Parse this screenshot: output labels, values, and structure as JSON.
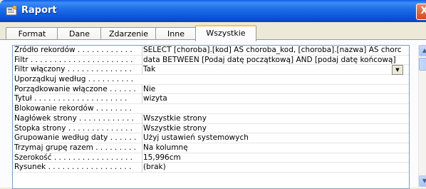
{
  "window": {
    "title": "Raport",
    "close_label": "X"
  },
  "tabs": [
    {
      "label": "Format"
    },
    {
      "label": "Dane"
    },
    {
      "label": "Zdarzenie"
    },
    {
      "label": "Inne"
    },
    {
      "label": "Wszystkie",
      "active": true
    }
  ],
  "properties": [
    {
      "label": "Źródło rekordów . . . . . . . . . . . .",
      "value": "SELECT [choroba].[kod] AS choroba_kod, [choroba].[nazwa] AS chorc"
    },
    {
      "label": "Filtr . . . . . . . . . . . . . . . . . . . . . .",
      "value": "data BETWEEN [Podaj datę początkową] AND [podaj datę końcową]"
    },
    {
      "label": "Filtr włączony . . . . . . . . . . . . . .",
      "value": "Tak"
    },
    {
      "label": "Uporządkuj według . . . . . . . . . .",
      "value": ""
    },
    {
      "label": "Porządkowanie włączone . . . . . .",
      "value": "Nie"
    },
    {
      "label": "Tytuł . . . . . . . . . . . . . . . . . . . .",
      "value": "wizyta"
    },
    {
      "label": "Blokowanie rekordów . . . . . . . .",
      "value": ""
    },
    {
      "label": "Nagłówek strony . . . . . . . . . . . .",
      "value": "Wszystkie strony"
    },
    {
      "label": "Stopka strony . . . . . . . . . . . . . .",
      "value": "Wszystkie strony"
    },
    {
      "label": "Grupowanie według daty . . . . . .",
      "value": "Użyj ustawień systemowych"
    },
    {
      "label": "Trzymaj grupę razem . . . . . . . . .",
      "value": "Na kolumnę"
    },
    {
      "label": "Szerokość . . . . . . . . . . . . . . . . .",
      "value": "15,996cm"
    },
    {
      "label": "Rysunek . . . . . . . . . . . . . . . . . .",
      "value": "(brak)"
    }
  ],
  "scroll": {
    "up_icon": "arrow-up-icon",
    "down_icon": "arrow-down-icon"
  }
}
